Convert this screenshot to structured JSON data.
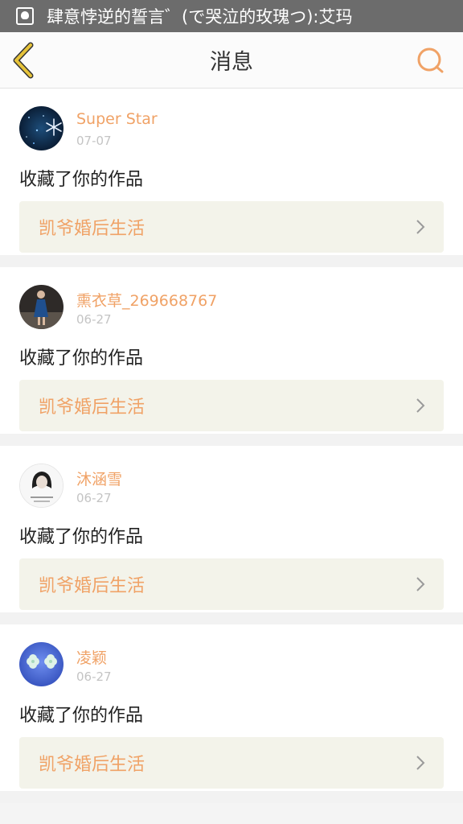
{
  "status_bar": {
    "notification_text": "肆意悖逆的誓言゛(で哭泣的玫瑰つ):艾玛"
  },
  "nav": {
    "title": "消息",
    "accent_color": "#f0a266",
    "back_icon_color": "#e6c33a"
  },
  "messages": [
    {
      "username": "Super Star",
      "date": "07-07",
      "action": "收藏了你的作品",
      "work_title": "凯爷婚后生活",
      "avatar_icon": "starry-snowflake-avatar"
    },
    {
      "username": "熏衣草_269668767",
      "date": "06-27",
      "action": "收藏了你的作品",
      "work_title": "凯爷婚后生活",
      "avatar_icon": "woman-in-blue-dress-avatar"
    },
    {
      "username": "沐涵雪",
      "date": "06-27",
      "action": "收藏了你的作品",
      "work_title": "凯爷婚后生活",
      "avatar_icon": "girl-portrait-avatar"
    },
    {
      "username": "凌颖",
      "date": "06-27",
      "action": "收藏了你的作品",
      "work_title": "凯爷婚后生活",
      "avatar_icon": "clover-blue-avatar"
    }
  ]
}
